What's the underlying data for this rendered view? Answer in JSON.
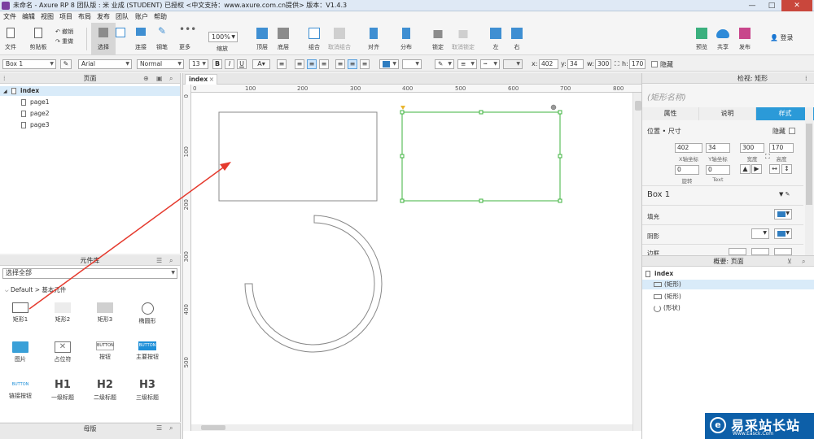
{
  "app": {
    "title": "未命名 - Axure RP 8 团队版 : 米 业成 (STUDENT) 已授权     <中文支持：www.axure.com.cn提供> 版本：V1.4.3"
  },
  "window_controls": {
    "minimize": "—",
    "maximize": "□",
    "close": "✕"
  },
  "menu": [
    "文件",
    "编辑",
    "视图",
    "项目",
    "布局",
    "发布",
    "团队",
    "账户",
    "帮助"
  ],
  "toolbar": {
    "file": "文件",
    "clipboard": "剪贴板",
    "undo": "撤销",
    "redo": "重做",
    "select": "选择",
    "connect": "连接",
    "pen": "钢笔",
    "more": "更多",
    "zoom_value": "100%",
    "zoom": "缩放",
    "top": "顶层",
    "bottom": "底层",
    "group": "组合",
    "ungroup": "取消组合",
    "align": "对齐",
    "distribute": "分布",
    "lock": "锁定",
    "unlock": "取消锁定",
    "left": "左",
    "right": "右",
    "preview": "预览",
    "share": "共享",
    "publish": "发布",
    "login": "登录"
  },
  "formatbar": {
    "widget_name": "Box 1",
    "font": "Arial",
    "style": "Normal",
    "size": "13",
    "bold": "B",
    "italic": "I",
    "underline": "U",
    "font_color": "A",
    "x_label": "x:",
    "x": "402",
    "y_label": "y:",
    "y": "34",
    "w_label": "w:",
    "w": "300",
    "h_label": "h:",
    "h": "170",
    "hidden": "隐藏"
  },
  "pages_panel": {
    "title": "页面",
    "root": "index",
    "pages": [
      "page1",
      "page2",
      "page3"
    ]
  },
  "widgets_panel": {
    "title": "元件库",
    "library": "选择全部",
    "category": "Default > 基本元件",
    "items": [
      {
        "label": "矩形1"
      },
      {
        "label": "矩形2"
      },
      {
        "label": "矩形3"
      },
      {
        "label": "椭圆形"
      },
      {
        "label": "图片"
      },
      {
        "label": "占位符"
      },
      {
        "label": "按钮",
        "text": "BUTTON"
      },
      {
        "label": "主要按钮",
        "text": "BUTTON"
      },
      {
        "label": "链接按钮",
        "text": "BUTTON"
      },
      {
        "label": "一级标题",
        "text": "H1"
      },
      {
        "label": "二级标题",
        "text": "H2"
      },
      {
        "label": "三级标题",
        "text": "H3"
      }
    ]
  },
  "masters_panel": {
    "title": "母版"
  },
  "canvas": {
    "tab": "index",
    "hruler": [
      "0",
      "100",
      "200",
      "300",
      "400",
      "500",
      "600",
      "700",
      "800"
    ],
    "vruler": [
      "0",
      "100",
      "200",
      "300",
      "400",
      "500"
    ],
    "accent": "#3cb33c"
  },
  "inspector": {
    "header": "检视: 矩形",
    "name_placeholder": "(矩形名称)",
    "tabs": [
      "属性",
      "说明",
      "样式"
    ],
    "pos_size": "位置 • 尺寸",
    "hidden": "隐藏",
    "x": "402",
    "x_label": "X轴坐标",
    "y": "34",
    "y_label": "Y轴坐标",
    "w": "300",
    "w_label": "宽度",
    "h": "170",
    "h_label": "高度",
    "rotate": "0",
    "rotate_label": "旋转",
    "text_rotate": "0",
    "text_rotate_label": "Text",
    "style_name": "Box 1",
    "fill": "填充",
    "shadow": "阴影",
    "border": "边框",
    "accent": "#2b9ad8"
  },
  "outline_panel": {
    "title": "概要: 页面",
    "root": "index",
    "items": [
      "(矩形)",
      "(矩形)",
      "(形状)"
    ]
  },
  "watermark": {
    "brand": "易采站长站",
    "sub": "Www.Easck.Com"
  }
}
